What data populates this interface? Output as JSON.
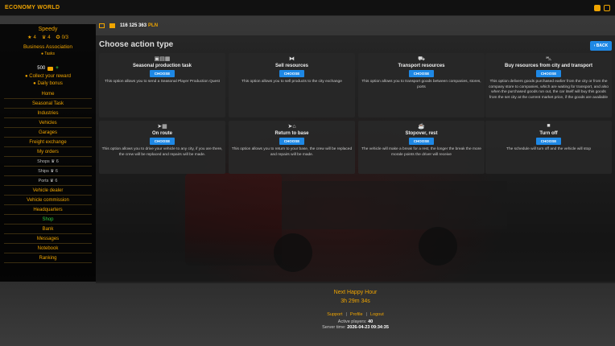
{
  "app": {
    "title": "ECONOMY WORLD"
  },
  "player": {
    "name": "Speedy",
    "stat_a": "4",
    "stat_b": "4",
    "stat_c": "0/3",
    "association": "Business Association",
    "tasks_label": "Tasks",
    "balance": "500",
    "reward_label": "Collect your reward",
    "bonus_label": "Daily bonus"
  },
  "menu": [
    {
      "label": "Home"
    },
    {
      "label": "Seasonal Task"
    },
    {
      "label": "Industries"
    },
    {
      "label": "Vehicles"
    },
    {
      "label": "Garages"
    },
    {
      "label": "Freight exchange"
    },
    {
      "label": "My orders"
    },
    {
      "label": "Shops",
      "count": "6"
    },
    {
      "label": "Ships",
      "count": "6"
    },
    {
      "label": "Ports",
      "count": "6"
    },
    {
      "label": "Vehicle dealer"
    },
    {
      "label": "Vehicle commission"
    },
    {
      "label": "Headquarters"
    },
    {
      "label": "Shop"
    },
    {
      "label": "Bank"
    },
    {
      "label": "Messages"
    },
    {
      "label": "Notebook"
    },
    {
      "label": "Ranking"
    }
  ],
  "info": {
    "money": "116 125 363",
    "currency": "PLN"
  },
  "main": {
    "title": "Choose action type",
    "back_label": "BACK",
    "choose_label": "CHOOSE",
    "cards": [
      {
        "icon": "tasks-icon",
        "title": "Seasonal production task",
        "desc": "This option allows you to send a Seasonal Player Production Quest"
      },
      {
        "icon": "handshake-icon",
        "title": "Sell resources",
        "desc": "This option allows you to sell products to the city exchange"
      },
      {
        "icon": "dolly-icon",
        "title": "Transport resources",
        "desc": "This option allows you to transport goods between companies, stores, ports"
      },
      {
        "icon": "cart-icon",
        "title": "Buy resources from city and transport",
        "desc": "This option delivers goods purchased earlier from the city or from the company store to companies, which are waiting for transport, and also when the purchased goods run out, the car itself will buy this goods from the set city at the current market price, if the goods are available"
      },
      {
        "icon": "truck-icon",
        "title": "On route",
        "desc": "This option allows you to drive your vehicle to any city, if you are there, the crew will be replaced and repairs will be made."
      },
      {
        "icon": "route-icon",
        "title": "Return to base",
        "desc": "This option allows you to return to your base, the crew will be replaced and repairs will be made."
      },
      {
        "icon": "coffee-icon",
        "title": "Stopover, rest",
        "desc": "The vehicle will make a break for a rest, the longer the break the more morale points the driver will receive"
      },
      {
        "icon": "stop-icon",
        "title": "Turn off",
        "desc": "The schedule will turn off and the vehicle will stop"
      }
    ]
  },
  "footer": {
    "happy_hour_title": "Next Happy Hour",
    "happy_hour_time": "3h 29m 34s",
    "link_support": "Support",
    "link_profile": "Profile",
    "link_logout": "Logout",
    "active_players_label": "Active players:",
    "active_players": "40",
    "server_time_label": "Server time:",
    "server_time": "2026-04-23 09:34:35"
  },
  "colors": {
    "accent": "#f0a500",
    "button": "#1e88e5",
    "active": "#2ecc40"
  }
}
